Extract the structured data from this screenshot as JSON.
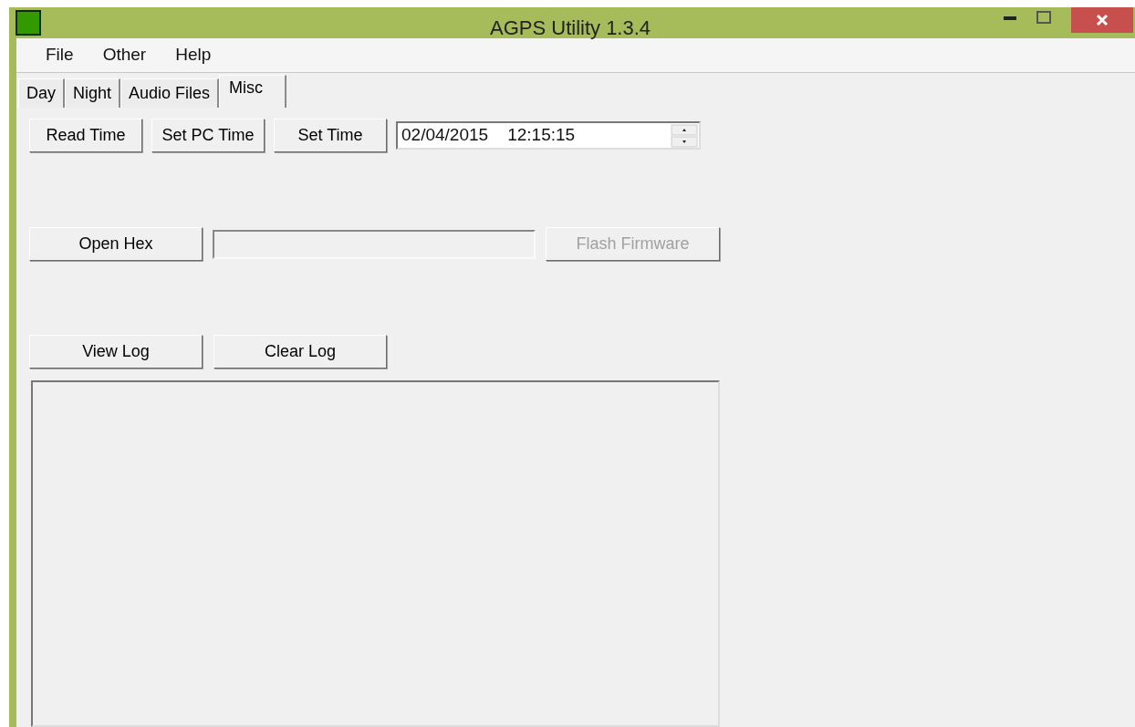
{
  "window": {
    "title": "AGPS Utility 1.3.4"
  },
  "menu": [
    "File",
    "Other",
    "Help"
  ],
  "tabs": [
    {
      "label": "Day",
      "selected": false
    },
    {
      "label": "Night",
      "selected": false
    },
    {
      "label": "Audio Files",
      "selected": false
    },
    {
      "label": "Misc",
      "selected": true
    }
  ],
  "time_buttons": [
    {
      "label": "Read Time",
      "disabled": false
    },
    {
      "label": "Set PC Time",
      "disabled": false
    },
    {
      "label": "Set Time",
      "disabled": false
    }
  ],
  "datetime": {
    "value": "02/04/2015    12:15:15"
  },
  "firmware": {
    "open_button": {
      "label": "Open Hex",
      "disabled": false
    },
    "flash_button": {
      "label": "Flash Firmware",
      "disabled": true
    }
  },
  "log_buttons": [
    {
      "label": "View Log",
      "disabled": false
    },
    {
      "label": "Clear Log",
      "disabled": false
    }
  ]
}
